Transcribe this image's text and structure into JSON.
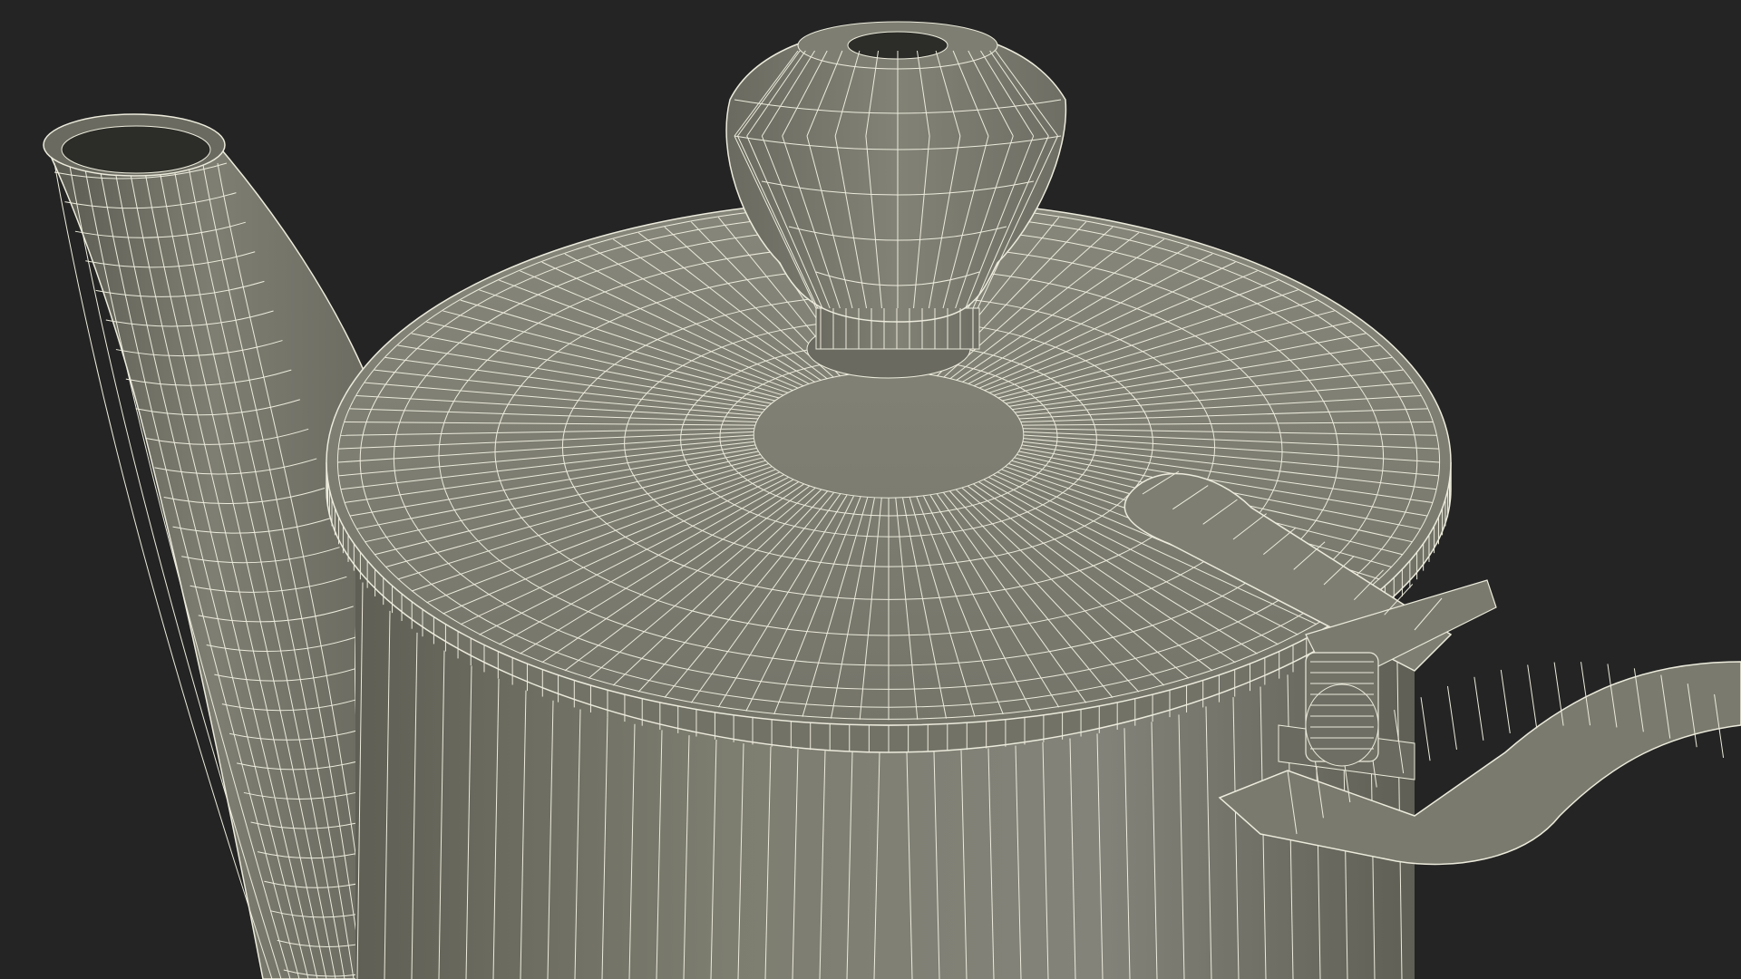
{
  "render": {
    "background_color": "#242424",
    "surface_color": "#7b7b6e",
    "surface_shadow_color": "#5f5f55",
    "surface_highlight_color": "#8c8c80",
    "wire_color": "#ecebdc"
  },
  "model": {
    "subject": "teapot",
    "display_mode": "wireframe-on-shaded",
    "parts": [
      "spout",
      "body",
      "lid",
      "knob",
      "hinge",
      "handle"
    ]
  }
}
